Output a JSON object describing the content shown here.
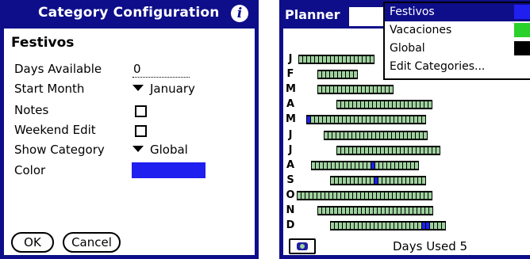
{
  "category_config": {
    "title": "Category Configuration",
    "info_icon": "info-icon",
    "category_name": "Festivos",
    "rows": {
      "days_available": {
        "label": "Days Available",
        "value": "0"
      },
      "start_month": {
        "label": "Start Month",
        "value": "January"
      },
      "notes": {
        "label": "Notes",
        "checked": false
      },
      "weekend_edit": {
        "label": "Weekend Edit",
        "checked": false
      },
      "show_category": {
        "label": "Show Category",
        "value": "Global"
      },
      "color": {
        "label": "Color",
        "value": "#1f1ff0"
      }
    },
    "buttons": {
      "ok": "OK",
      "cancel": "Cancel"
    }
  },
  "planner": {
    "title": "Planner",
    "months": [
      "J",
      "F",
      "M",
      "A",
      "M",
      "J",
      "J",
      "A",
      "S",
      "O",
      "N",
      "D"
    ],
    "category_menu": {
      "items": [
        {
          "label": "Festivos",
          "color": "#1f1ff0",
          "selected": true
        },
        {
          "label": "Vacaciones",
          "color": "#2ad12a",
          "selected": false
        },
        {
          "label": "Global",
          "color": "#000000",
          "selected": false
        },
        {
          "label": "Edit Categories...",
          "color": null,
          "selected": false
        }
      ]
    },
    "footer": {
      "days_used": "Days Used 5",
      "icon": "planner-view-icon"
    },
    "colors": {
      "workday": "#9ed09e",
      "holiday": "#1f1ff0",
      "titlebar": "#0e0e8a"
    }
  }
}
